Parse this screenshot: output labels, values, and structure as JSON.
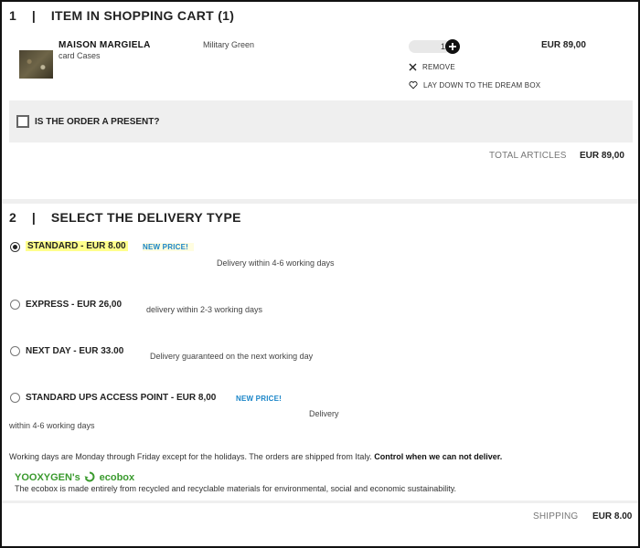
{
  "cart": {
    "heading": "1    |    ITEM IN SHOPPING CART (1)",
    "item": {
      "brand": "MAISON MARGIELA",
      "product": "card Cases",
      "color": "Military Green",
      "quantity": "1",
      "price": "EUR 89,00",
      "remove_label": "REMOVE",
      "dream_box_label": "LAY DOWN TO THE DREAM BOX"
    },
    "present_label": "IS THE ORDER A PRESENT?",
    "total_label": "TOTAL ARTICLES",
    "total_value": "EUR 89,00"
  },
  "delivery": {
    "heading": "2    |    SELECT THE DELIVERY TYPE",
    "options": [
      {
        "label": "STANDARD - EUR 8.00",
        "badge": "NEW PRICE!",
        "desc": "Delivery within 4-6 working days",
        "selected": true
      },
      {
        "label": "EXPRESS - EUR 26,00",
        "desc": "delivery within 2-3 working days",
        "selected": false
      },
      {
        "label": "NEXT DAY - EUR 33.00",
        "desc": "Delivery guaranteed on the next working day",
        "selected": false
      },
      {
        "label": "STANDARD UPS ACCESS POINT - EUR 8,00",
        "badge": "NEW PRICE!",
        "desc_line1": "Delivery",
        "desc_line2": "within 4-6 working days",
        "selected": false
      }
    ],
    "working_days_note": "Working days are Monday through Friday except for the holidays. The orders are shipped from Italy.",
    "control_link": "Control when we can not deliver.",
    "ecobox_prefix": "YOOXYGEN's",
    "ecobox_word": "ecobox",
    "ecobox_desc": "The ecobox is made entirely from recycled and recyclable materials for environmental, social and economic sustainability.",
    "shipping_label": "SHIPPING",
    "shipping_value": "EUR 8.00"
  },
  "colors": {
    "highlight": "#ffff8c",
    "new_price": "#1a85c8",
    "ecobox_green": "#3a9a2e",
    "panel_grey": "#efefef"
  }
}
